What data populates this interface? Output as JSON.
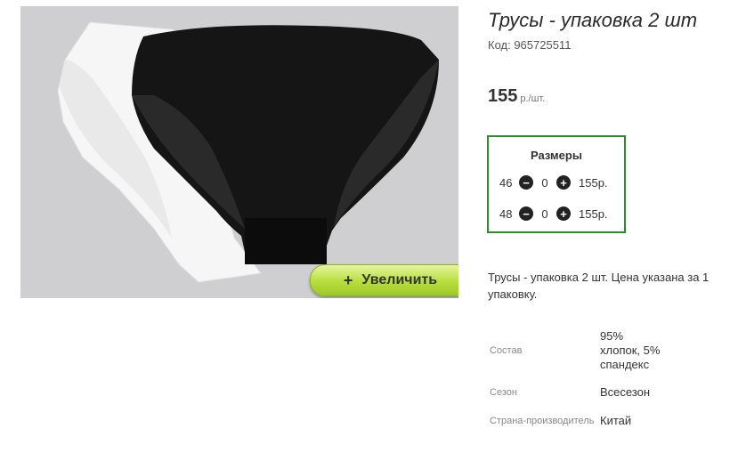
{
  "product": {
    "title": "Трусы - упаковка 2 шт",
    "code": "Код: 965725511",
    "price": "155",
    "price_unit": "р./шт."
  },
  "zoom": {
    "plus": "+",
    "label": "Увеличить"
  },
  "sizes": {
    "header": "Размеры",
    "rows": [
      {
        "size": "46",
        "qty": "0",
        "price": "155р."
      },
      {
        "size": "48",
        "qty": "0",
        "price": "155р."
      }
    ],
    "minus": "−",
    "plus": "+"
  },
  "description": "Трусы - упаковка 2 шт. Цена указана за 1 упаковку.",
  "properties": [
    {
      "label": "Состав",
      "value": "95% хлопок, 5% спандекс"
    },
    {
      "label": "Сезон",
      "value": "Всесезон"
    },
    {
      "label": "Страна-производитель",
      "value": "Китай"
    }
  ],
  "colors": {
    "accent_border": "#2e8b2e",
    "zoom_button": "#b7de3c",
    "photo_bg": "#cfcfd1"
  }
}
